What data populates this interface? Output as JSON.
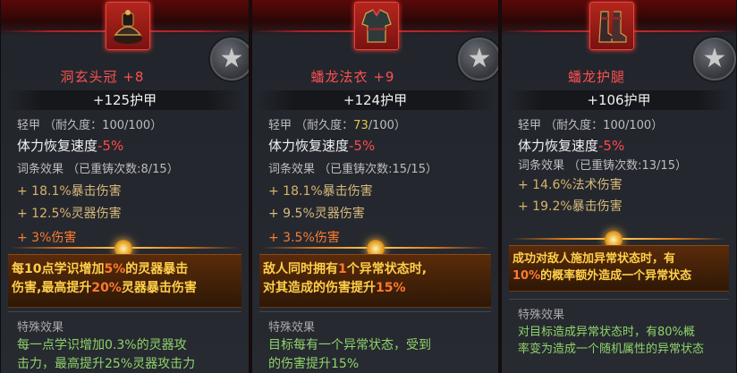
{
  "panels": [
    {
      "title": "洞玄头冠 +8",
      "armor_plus": "+",
      "armor_value": "125",
      "armor_label": "护甲",
      "weight": "轻甲",
      "durability_label": "（耐久度：",
      "durability_current": "100",
      "durability_max": "/100）",
      "stamina_label": "体力恢复速度",
      "stamina_value": "-5%",
      "affix_header": "词条效果 （已重铸次数:8/15）",
      "affix1_value": "+ 18.1%",
      "affix1_label": "暴击伤害",
      "affix2_value": "+ 12.5%",
      "affix2_label": "灵器伤害",
      "affix3": "+ 3%伤害",
      "set_line1_a": "每10点学识增加",
      "set_line1_b": "5%",
      "set_line1_c": "的灵器暴击",
      "set_line2_a": "伤害,最高提升",
      "set_line2_b": "20%",
      "set_line2_c": "灵器暴击伤害",
      "special_title": "特殊效果",
      "special_line1": "每一点学识增加0.3%的灵器攻",
      "special_line2": "击力，最高提升25%灵器攻击力"
    },
    {
      "title": "蟠龙法衣 +9",
      "armor_plus": "+",
      "armor_value": "124",
      "armor_label": "护甲",
      "weight": "轻甲",
      "durability_label": "（耐久度：",
      "durability_current": "73",
      "durability_max": "/100）",
      "stamina_label": "体力恢复速度",
      "stamina_value": "-5%",
      "affix_header": "词条效果 （已重铸次数:15/15）",
      "affix1_value": "+ 18.1%",
      "affix1_label": "暴击伤害",
      "affix2_value": "+ 9.5%",
      "affix2_label": "灵器伤害",
      "affix3": "+ 3.5%伤害",
      "set_line1_a": "敌人同时拥有",
      "set_line1_b": "1",
      "set_line1_c": "个异常状态时,",
      "set_line2_a": "对其造成的伤害提升",
      "set_line2_b": "15%",
      "set_line2_c": "",
      "special_title": "特殊效果",
      "special_line1": "目标每有一个异常状态，受到",
      "special_line2": "的伤害提升15%"
    },
    {
      "title": "蟠龙护腿",
      "armor_plus": "+",
      "armor_value": "106",
      "armor_label": "护甲",
      "weight": "轻甲",
      "durability_label": "（耐久度：",
      "durability_current": "100",
      "durability_max": "/100）",
      "stamina_label": "体力恢复速度",
      "stamina_value": "-5%",
      "affix_header": "词条效果 （已重铸次数:13/15）",
      "affix1_value": "+ 14.6%",
      "affix1_label": "法术伤害",
      "affix2_value": "+ 19.2%",
      "affix2_label": "暴击伤害",
      "set_line1_a": "成功对敌人施加异常状态时，有",
      "set_line2_a": "10%",
      "set_line2_b": "的概率额外造成一个异常状态",
      "special_title": "特殊效果",
      "special_line1": "对目标造成异常状态时，有80%概",
      "special_line2": "率变为造成一个随机属性的异常状态"
    }
  ],
  "icons": [
    "helmet-icon",
    "robe-icon",
    "boots-icon",
    "star-icon"
  ],
  "colors": {
    "title_red": "#ff5050",
    "set_yellow": "#ffcf4a",
    "special_green": "#8fd36a",
    "affix_tan": "#d6b97a",
    "purple": "#b99bff"
  }
}
